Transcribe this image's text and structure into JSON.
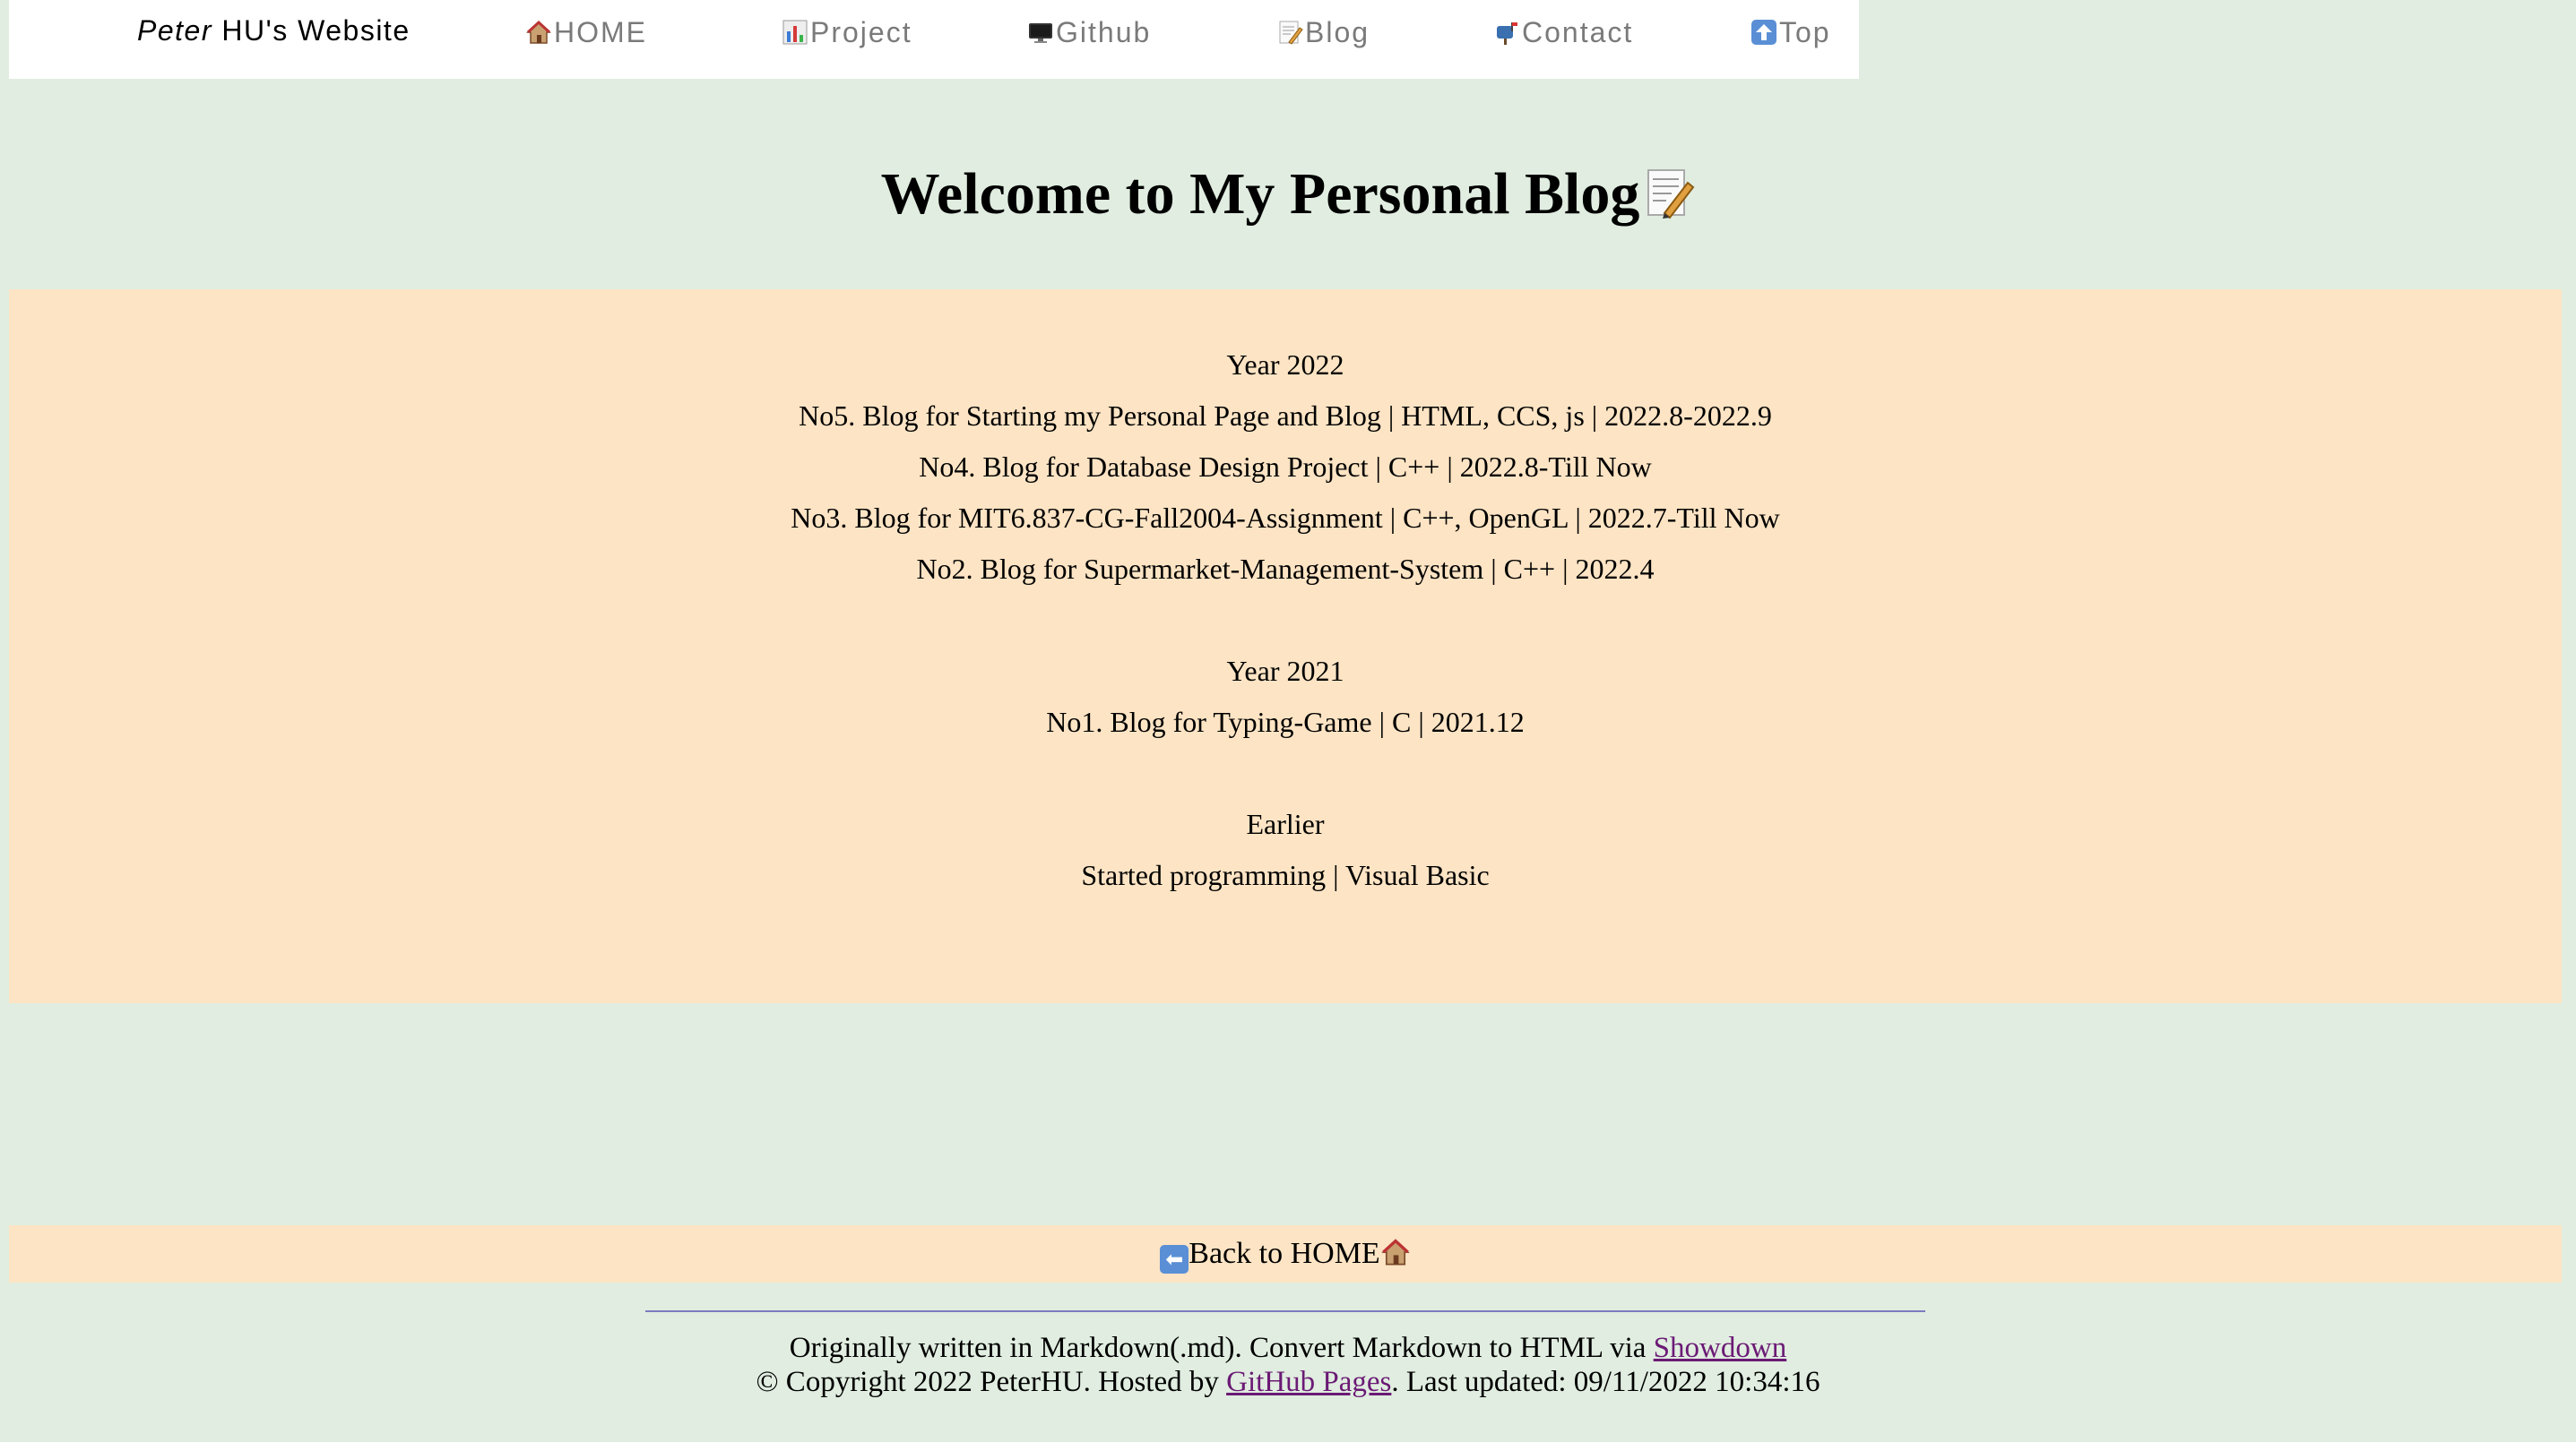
{
  "nav": {
    "brand_first": "Peter",
    "brand_rest": " HU's Website",
    "items": [
      {
        "label": "HOME",
        "icon": "house-icon"
      },
      {
        "label": "Project",
        "icon": "bar-chart-icon"
      },
      {
        "label": "Github",
        "icon": "computer-icon"
      },
      {
        "label": "Blog",
        "icon": "memo-icon"
      },
      {
        "label": "Contact",
        "icon": "mailbox-icon"
      },
      {
        "label": "Top",
        "icon": "up-arrow-icon"
      }
    ]
  },
  "page_title": "Welcome to My Personal Blog",
  "blog": {
    "sections": [
      {
        "heading": "Year 2022",
        "entries": [
          "No5. Blog for Starting my Personal Page and Blog | HTML, CCS, js | 2022.8-2022.9",
          "No4. Blog for Database Design Project | C++ | 2022.8-Till Now",
          "No3. Blog for MIT6.837-CG-Fall2004-Assignment | C++, OpenGL | 2022.7-Till Now",
          "No2. Blog for Supermarket-Management-System | C++ | 2022.4"
        ]
      },
      {
        "heading": "Year 2021",
        "entries": [
          "No1. Blog for Typing-Game | C | 2021.12"
        ]
      },
      {
        "heading": "Earlier",
        "entries": [
          "Started programming | Visual Basic"
        ]
      }
    ]
  },
  "back_home_label": "Back to HOME",
  "footer": {
    "line1_text": "Originally written in Markdown(.md). Convert Markdown to HTML via ",
    "line1_link": "Showdown",
    "line2_text_a": "© Copyright 2022 PeterHU. Hosted by ",
    "line2_link": "GitHub Pages",
    "line2_text_b": ". Last updated: 09/11/2022 10:34:16"
  },
  "colors": {
    "page_bg": "#e0ede0",
    "panel_bg": "#fde4c4",
    "nav_text": "#7a7a7a",
    "link": "#6b1a75",
    "divider": "#7b7bc0"
  }
}
